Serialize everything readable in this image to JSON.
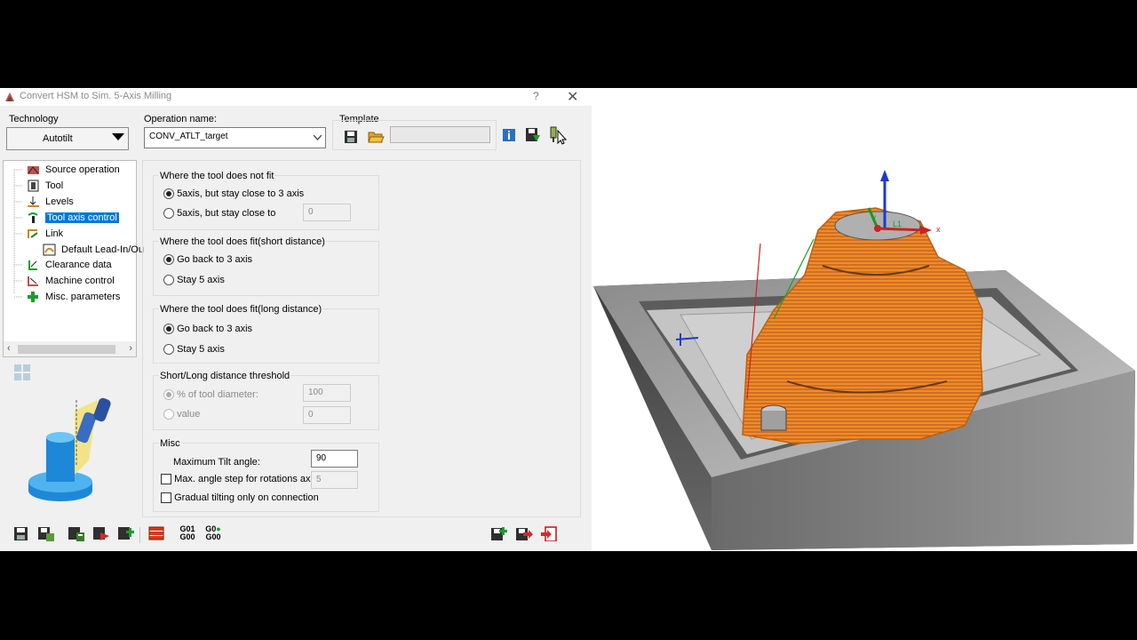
{
  "dialog": {
    "title": "Convert HSM to Sim. 5-Axis Milling",
    "help_button": "?",
    "close_button": "✕"
  },
  "technology": {
    "label": "Technology",
    "value": "Autotilt"
  },
  "operation_name": {
    "label": "Operation name:",
    "value": "CONV_ATLT_target"
  },
  "template": {
    "label": "Template",
    "value": ""
  },
  "tree": {
    "items": [
      {
        "label": "Source operation",
        "icon": "source-operation-icon"
      },
      {
        "label": "Tool",
        "icon": "tool-icon"
      },
      {
        "label": "Levels",
        "icon": "levels-icon"
      },
      {
        "label": "Tool axis control",
        "icon": "tool-axis-icon",
        "selected": true
      },
      {
        "label": "Link",
        "icon": "link-icon"
      },
      {
        "label": "Default Lead-In/Ou",
        "icon": "lead-in-icon"
      },
      {
        "label": "Clearance data",
        "icon": "clearance-icon"
      },
      {
        "label": "Machine control",
        "icon": "machine-control-icon"
      },
      {
        "label": "Misc. parameters",
        "icon": "misc-parameters-icon"
      }
    ]
  },
  "groups": {
    "not_fit": {
      "title": "Where the tool does not fit",
      "opt1": "5axis, but stay close to 3 axis",
      "opt2": "5axis, but stay close to",
      "opt2_value": "0"
    },
    "fit_short": {
      "title": "Where the tool does fit(short distance)",
      "opt1": "Go back to 3 axis",
      "opt2": "Stay 5 axis"
    },
    "fit_long": {
      "title": "Where the tool does fit(long distance)",
      "opt1": "Go back to 3 axis",
      "opt2": "Stay 5 axis"
    },
    "threshold": {
      "title": "Short/Long distance threshold",
      "opt1": "% of tool diameter:",
      "opt1_value": "100",
      "opt2": "value",
      "opt2_value": "0"
    },
    "misc": {
      "title": "Misc",
      "max_tilt_label": "Maximum Tilt angle:",
      "max_tilt_value": "90",
      "max_step_label": "Max. angle step for rotations axis",
      "max_step_value": "5",
      "gradual_label": "Gradual tilting only on connection"
    }
  },
  "bottom": {
    "g1_top": "G01",
    "g1_bot": "G00",
    "g2_top": "G0",
    "g2_bot": "G00"
  },
  "viewport": {
    "axis_z": "z",
    "axis_x": "x",
    "axis_y": "y",
    "coord_label": "L1"
  },
  "colors": {
    "accent": "#0078d7",
    "toolpath": "#f08020",
    "part": "#a8a8a8"
  }
}
